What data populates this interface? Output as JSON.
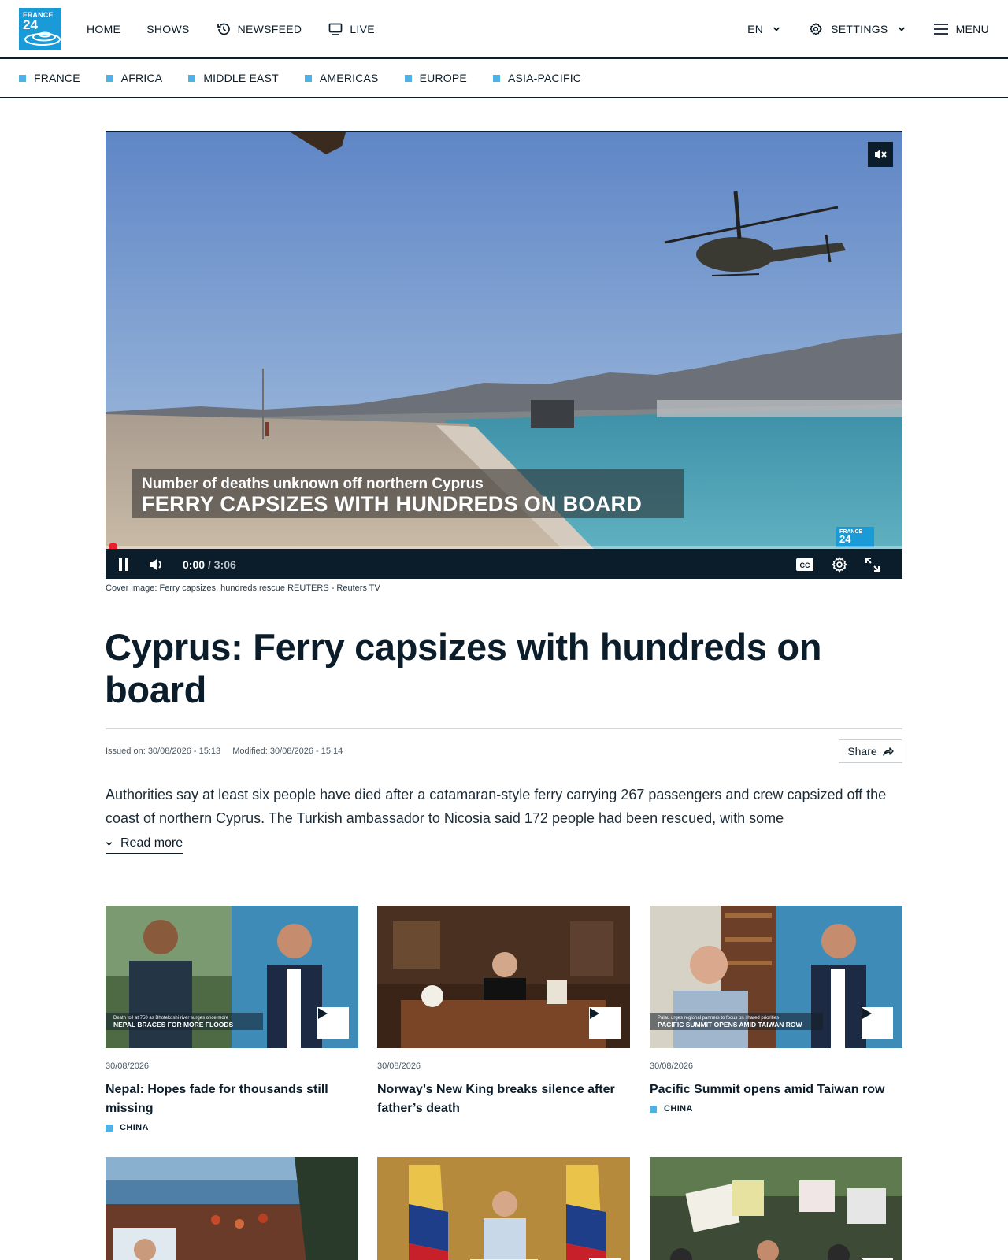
{
  "header": {
    "logo_line1": "FRANCE",
    "logo_line2": "24",
    "nav": [
      {
        "label": "HOME"
      },
      {
        "label": "SHOWS"
      },
      {
        "label": "NEWSFEED",
        "icon": "history-icon"
      },
      {
        "label": "LIVE",
        "icon": "monitor-icon"
      }
    ],
    "language": "EN",
    "settings_label": "SETTINGS",
    "menu_label": "MENU"
  },
  "regions": [
    "FRANCE",
    "AFRICA",
    "MIDDLE EAST",
    "AMERICAS",
    "EUROPE",
    "ASIA-PACIFIC"
  ],
  "player": {
    "overlay_subtitle": "Number of deaths unknown off northern Cyprus",
    "overlay_headline": "FERRY CAPSIZES WITH HUNDREDS ON BOARD",
    "watermark_line1": "FRANCE",
    "watermark_line2": "24",
    "current_time": "0:00",
    "duration": "/ 3:06",
    "progress_fraction": 0.0,
    "muted": true,
    "cc_label": "CC"
  },
  "caption": "Cover image: Ferry capsizes, hundreds rescue REUTERS - Reuters TV",
  "article": {
    "headline": "Cyprus: Ferry capsizes with hundreds on board",
    "issued": "Issued on: 30/08/2026 - 15:13",
    "modified": "Modified: 30/08/2026 - 15:14",
    "share_label": "Share",
    "lede": "Authorities say at least six people have died after a catamaran-style ferry carrying 267 passengers and crew capsized off the coast of northern Cyprus. The Turkish ambassador to Nicosia said 172 people had been rescued, with some",
    "read_more": "Read more"
  },
  "cards": [
    {
      "date": "30/08/2026",
      "title": "Nepal: Hopes fade for thousands still missing",
      "tag": "CHINA",
      "thumb_sub": "Death toll at 750 as Bhotekoshi river surges once more",
      "thumb_head": "NEPAL BRACES FOR MORE FLOODS"
    },
    {
      "date": "30/08/2026",
      "title": "Norway’s New King breaks silence after father’s death",
      "tag": "",
      "thumb_sub": "",
      "thumb_head": ""
    },
    {
      "date": "30/08/2026",
      "title": "Pacific Summit opens amid Taiwan row",
      "tag": "CHINA",
      "thumb_sub": "Palau urges regional partners to focus on shared priorities",
      "thumb_head": "PACIFIC SUMMIT OPENS AMID TAIWAN ROW"
    }
  ],
  "colors": {
    "brand": "#1a9ad6",
    "accent_square": "#4fb2e6",
    "ink": "#0b1d2a",
    "progress_dot": "#e8202a"
  }
}
